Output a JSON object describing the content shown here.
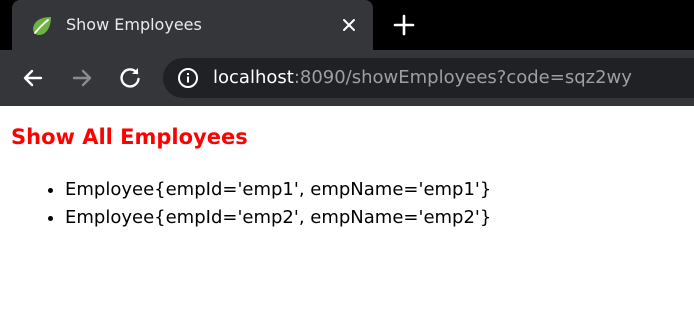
{
  "browser": {
    "tab": {
      "title": "Show Employees",
      "favicon": "spring-leaf-icon",
      "close_icon": "close-icon"
    },
    "new_tab_icon": "plus-icon",
    "toolbar": {
      "back_icon": "arrow-left-icon",
      "forward_icon": "arrow-right-icon",
      "reload_icon": "reload-icon",
      "info_icon": "info-icon"
    },
    "url": {
      "host": "localhost",
      "rest": ":8090/showEmployees?code=sqz2wy"
    }
  },
  "page": {
    "title": "Show All Employees",
    "employees": [
      "Employee{empId='emp1', empName='emp1'}",
      "Employee{empId='emp2', empName='emp2'}"
    ]
  },
  "colors": {
    "tabstrip_bg": "#000000",
    "tab_bg": "#35363a",
    "omnibox_bg": "#202124",
    "title_red": "#ff0000",
    "spring_green": "#6db33f"
  }
}
